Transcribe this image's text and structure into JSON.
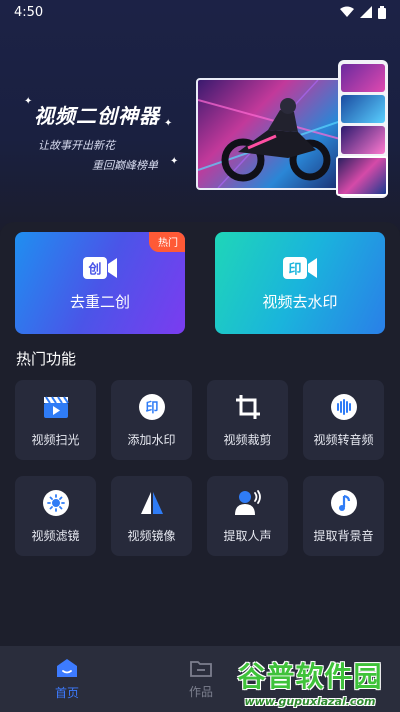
{
  "status_bar": {
    "time": "4:50"
  },
  "banner": {
    "title": "视频二创神器",
    "subtitle_line1": "让故事开出新花",
    "subtitle_line2": "重回巅峰榜单"
  },
  "feature_cards": [
    {
      "label": "去重二创",
      "badge": "热门",
      "icon": "dedup-camera-icon",
      "icon_text": "创"
    },
    {
      "label": "视频去水印",
      "icon": "watermark-camera-icon",
      "icon_text": "印"
    }
  ],
  "section_title": "热门功能",
  "tools": [
    {
      "label": "视频扫光",
      "icon": "clapper-icon"
    },
    {
      "label": "添加水印",
      "icon": "stamp-icon",
      "icon_text": "印"
    },
    {
      "label": "视频裁剪",
      "icon": "crop-icon"
    },
    {
      "label": "视频转音频",
      "icon": "audio-wave-icon"
    },
    {
      "label": "视频滤镜",
      "icon": "filter-icon"
    },
    {
      "label": "视频镜像",
      "icon": "mirror-icon"
    },
    {
      "label": "提取人声",
      "icon": "voice-person-icon"
    },
    {
      "label": "提取背景音",
      "icon": "music-note-icon"
    }
  ],
  "tabbar": [
    {
      "label": "首页",
      "icon": "home-icon",
      "active": true
    },
    {
      "label": "作品",
      "icon": "folder-icon",
      "active": false
    }
  ],
  "watermark": {
    "title": "谷普软件园",
    "url": "www.gupuxlazal.com"
  },
  "colors": {
    "accent": "#3d7bff",
    "badge": "#ff5a36",
    "tile_bg": "#272a3b",
    "page_bg": "#1d1f2c"
  }
}
